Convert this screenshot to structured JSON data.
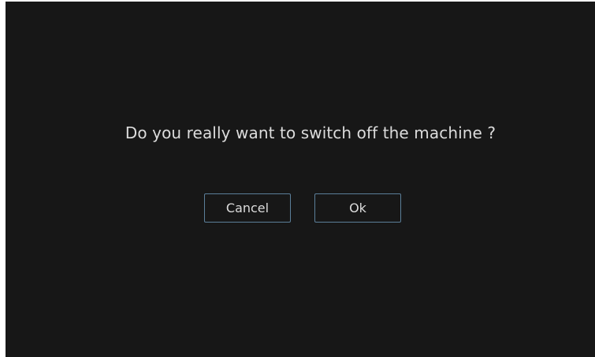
{
  "dialog": {
    "message": "Do you really want to switch off the machine ?",
    "cancel_label": "Cancel",
    "ok_label": "Ok"
  },
  "colors": {
    "background": "#171717",
    "text": "#dcdcdc",
    "button_border": "#5b7f9a"
  }
}
